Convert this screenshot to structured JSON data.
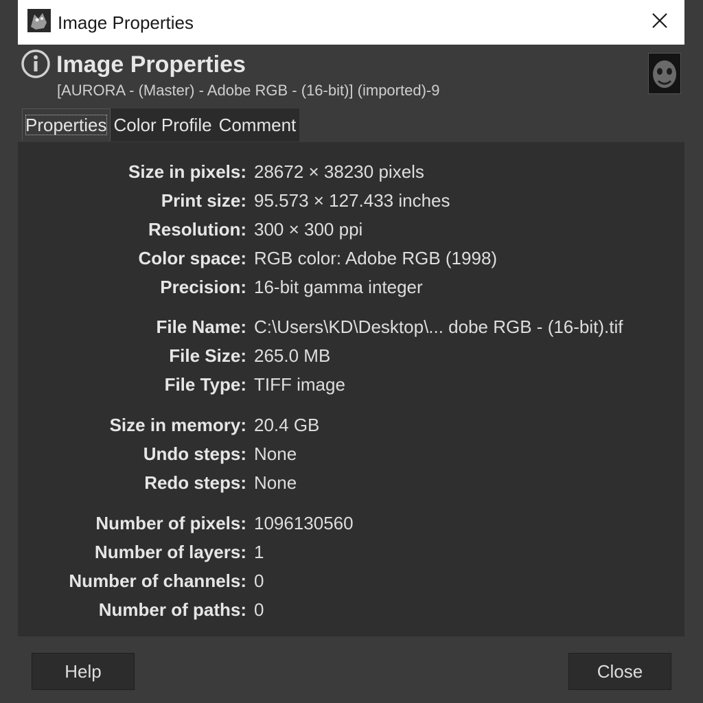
{
  "window": {
    "title": "Image Properties",
    "icons": {
      "app": "gimp-app-icon",
      "close": "close-icon"
    }
  },
  "header": {
    "title": "Image Properties",
    "subtitle": "[AURORA - (Master) - Adobe RGB - (16-bit)] (imported)-9",
    "icon": "info-icon"
  },
  "tabs": [
    {
      "label": "Properties"
    },
    {
      "label": "Color Profile"
    },
    {
      "label": "Comment"
    }
  ],
  "properties": {
    "size_pixels": {
      "label": "Size in pixels:",
      "value": "28672 × 38230 pixels"
    },
    "print_size": {
      "label": "Print size:",
      "value": "95.573 × 127.433 inches"
    },
    "resolution": {
      "label": "Resolution:",
      "value": "300 × 300 ppi"
    },
    "color_space": {
      "label": "Color space:",
      "value": "RGB color: Adobe RGB (1998)"
    },
    "precision": {
      "label": "Precision:",
      "value": "16-bit gamma integer"
    },
    "file_name": {
      "label": "File Name:",
      "value": "C:\\Users\\KD\\Desktop\\... dobe RGB - (16-bit).tif"
    },
    "file_size": {
      "label": "File Size:",
      "value": "265.0 MB"
    },
    "file_type": {
      "label": "File Type:",
      "value": "TIFF image"
    },
    "size_memory": {
      "label": "Size in memory:",
      "value": "20.4 GB"
    },
    "undo_steps": {
      "label": "Undo steps:",
      "value": "None"
    },
    "redo_steps": {
      "label": "Redo steps:",
      "value": "None"
    },
    "num_pixels": {
      "label": "Number of pixels:",
      "value": "1096130560"
    },
    "num_layers": {
      "label": "Number of layers:",
      "value": "1"
    },
    "num_channels": {
      "label": "Number of channels:",
      "value": "0"
    },
    "num_paths": {
      "label": "Number of paths:",
      "value": "0"
    }
  },
  "buttons": {
    "help": "Help",
    "close": "Close"
  }
}
